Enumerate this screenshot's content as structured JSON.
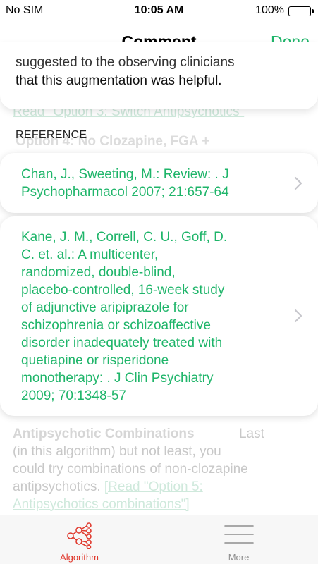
{
  "status_bar": {
    "carrier": "No SIM",
    "time": "10:05 AM",
    "battery": "100%"
  },
  "nav": {
    "title": "Comment",
    "done_label": "Done"
  },
  "background": {
    "link_line": "Read \"Option 3: Switch Antipsychotics\"",
    "heading_line": "Option 4: No Clozapine, FGA +",
    "section_heading": "Antipsychotic Combinations",
    "section_last_word": "Last",
    "lines": [
      "(in this algorithm) but not least, you",
      "could try combinations of non-clozapine",
      "antipsychotics."
    ],
    "link_part1": "[Read \"Option 5:",
    "link_part2": "Antipsychotics combinations\"]"
  },
  "comment_card": {
    "cut_line": "suggested to the observing clinicians",
    "last_line": "that this augmentation was helpful."
  },
  "reference": {
    "label": "REFERENCE",
    "items": [
      {
        "lines": [
          "Chan, J., Sweeting, M.: Review: . J",
          "Psychopharmacol 2007; 21:657-64"
        ]
      },
      {
        "lines": [
          "Kane, J. M., Correll, C. U., Goff, D.",
          "C. et. al.: A multicenter,",
          "randomized, double-blind,",
          "placebo-controlled, 16-week study",
          "of adjunctive aripiprazole for",
          "schizophrenia or schizoaffective",
          "disorder inadequately treated with",
          "quetiapine or risperidone",
          "monotherapy: . J Clin Psychiatry",
          "2009; 70:1348-57"
        ]
      }
    ]
  },
  "tabs": {
    "algorithm_label": "Algorithm",
    "more_label": "More"
  },
  "colors": {
    "accent_green": "#1fb56a",
    "active_tab_red": "#e03a2e",
    "inactive_tab_gray": "#8e8e8e"
  }
}
